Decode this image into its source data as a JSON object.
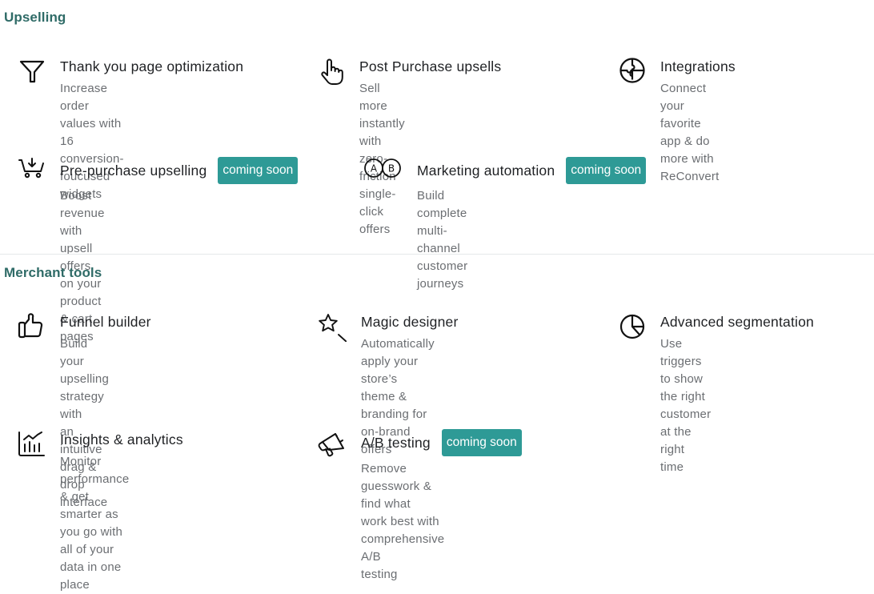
{
  "sections": [
    {
      "title": "Upselling",
      "features": [
        {
          "icon": "funnel-icon",
          "title": "Thank you page optimization",
          "badge": "",
          "desc": [
            "Increase order values with 16",
            "conversion-foucused widgets"
          ]
        },
        {
          "icon": "pointer-hand-icon",
          "title": "Post Purchase upsells",
          "badge": "",
          "desc": [
            "Sell more instantly with zero-",
            "friction single-click offers"
          ]
        },
        {
          "icon": "puzzle-circle-icon",
          "title": "Integrations",
          "badge": "",
          "desc": [
            "Connect your favorite app & do",
            "more with ReConvert"
          ]
        },
        {
          "icon": "cart-download-icon",
          "title": "Pre-purchase upselling",
          "badge": "coming soon",
          "desc": [
            "Boost revenue with upsell offers",
            "on your product & cart pages"
          ]
        },
        {
          "icon": "ab-circles-icon",
          "title": "Marketing automation",
          "badge": "coming soon",
          "desc": [
            "Build complete multi-channel",
            "customer journeys"
          ]
        }
      ]
    },
    {
      "title": "Merchant tools",
      "features": [
        {
          "icon": "thumbs-up-icon",
          "title": "Funnel builder",
          "badge": "",
          "desc": [
            "Build your upselling strategy with",
            "an intuitive drag & drop interface"
          ]
        },
        {
          "icon": "magic-wand-star-icon",
          "title": "Magic designer",
          "badge": "",
          "desc": [
            "Automatically apply your store’s",
            "theme & branding for on-brand",
            "offers"
          ]
        },
        {
          "icon": "pie-chart-icon",
          "title": "Advanced segmentation",
          "badge": "",
          "desc": [
            "Use triggers to show the right",
            "customer at the right time"
          ]
        },
        {
          "icon": "bar-chart-icon",
          "title": "Insights & analytics",
          "badge": "",
          "desc": [
            "Monitor performance & get",
            "smarter as you go with all of your",
            "data in one place"
          ]
        },
        {
          "icon": "megaphone-icon",
          "title": "A/B testing",
          "badge": "coming soon",
          "desc": [
            "Remove guesswork & find what",
            "work best with comprehensive A/B",
            "testing"
          ]
        }
      ]
    }
  ],
  "colors": {
    "section_title": "#2f6b67",
    "badge_bg": "#2e9a96",
    "badge_text": "#ffffff",
    "title": "#1f2124",
    "desc": "#6b6e72"
  }
}
